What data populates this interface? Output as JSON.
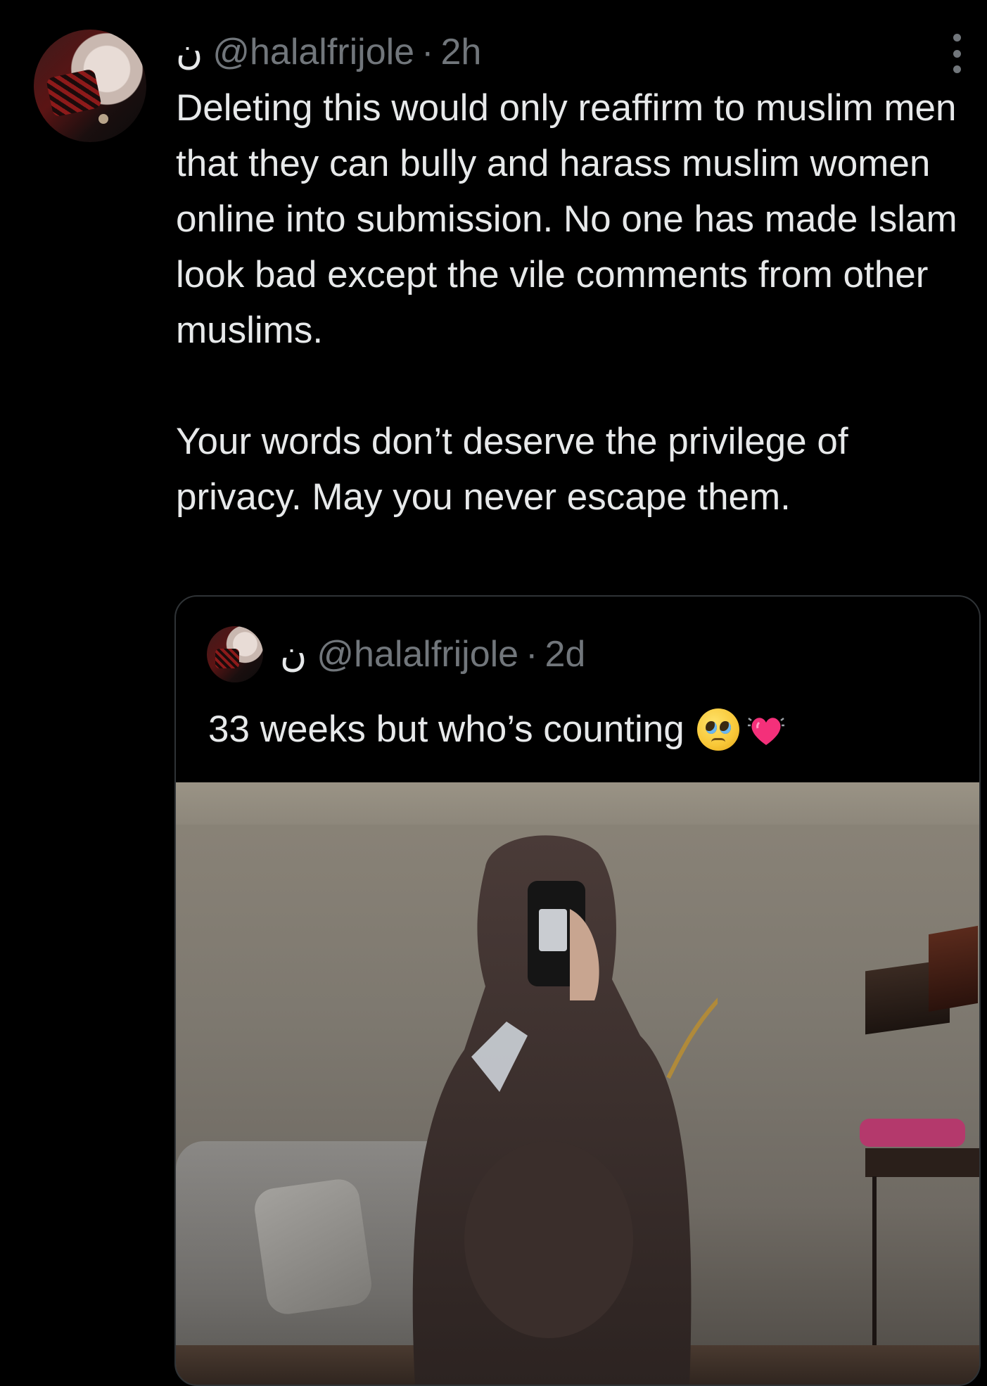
{
  "tweet": {
    "display_name": "ن",
    "handle": "@halalfrijole",
    "separator": "·",
    "time": "2h",
    "paragraphs": [
      "Deleting this would only reaffirm to muslim men that they can bully and harass muslim women online into submission. No one has made Islam look bad except the vile comments from other muslims.",
      "Your words don’t deserve the privilege of privacy. May you never escape them."
    ],
    "more_icon": "more-dots-vertical-icon"
  },
  "quote": {
    "display_name": "ن",
    "handle": "@halalfrijole",
    "separator": "·",
    "time": "2d",
    "text": "33 weeks but who’s counting",
    "emojis": [
      "pleading-face-tears-icon",
      "growing-heart-icon"
    ]
  },
  "colors": {
    "background": "#000000",
    "text_primary": "#e7e9ea",
    "text_secondary": "#71767b",
    "border": "#2f3336"
  }
}
